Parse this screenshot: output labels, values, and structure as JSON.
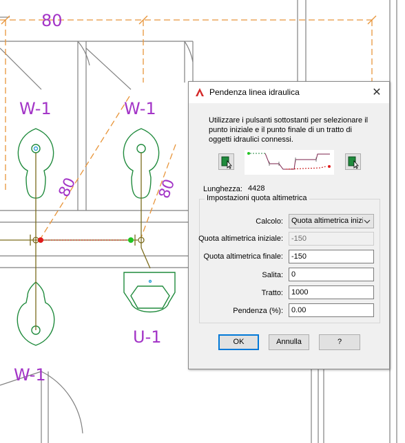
{
  "drawing": {
    "dimension": "80",
    "fixtures": {
      "wc_top_left": "W-1",
      "wc_top_right": "W-1",
      "wc_bottom": "W-1",
      "urinal": "U-1"
    },
    "side_dimension_left": "80",
    "diagonal_dimension_1": "80",
    "diagonal_dimension_2": "80"
  },
  "dialog": {
    "title": "Pendenza linea idraulica",
    "instructions": "Utilizzare i pulsanti sottostanti per selezionare il punto iniziale e il punto finale di un tratto di oggetti idraulici connessi.",
    "length_label": "Lunghezza:",
    "length_value": "4428",
    "group_title": "Impostazioni quota altimetrica",
    "calc_label": "Calcolo:",
    "calc_value": "Quota altimetrica inizi",
    "start_label": "Quota altimetrica iniziale:",
    "start_value": "-150",
    "end_label": "Quota altimetrica finale:",
    "end_value": "-150",
    "rise_label": "Salita:",
    "rise_value": "0",
    "run_label": "Tratto:",
    "run_value": "1000",
    "slope_label": "Pendenza (%):",
    "slope_value": "0.00",
    "ok_label": "OK",
    "cancel_label": "Annulla",
    "help_label": "?",
    "close_glyph": "✕"
  },
  "colors": {
    "dimension": "#e8953a",
    "text": "#a335c7",
    "fixture": "#1f8a3c",
    "pipe": "#7a6a1a",
    "accent": "#0078d7",
    "title_icon": "#d42a2a"
  }
}
